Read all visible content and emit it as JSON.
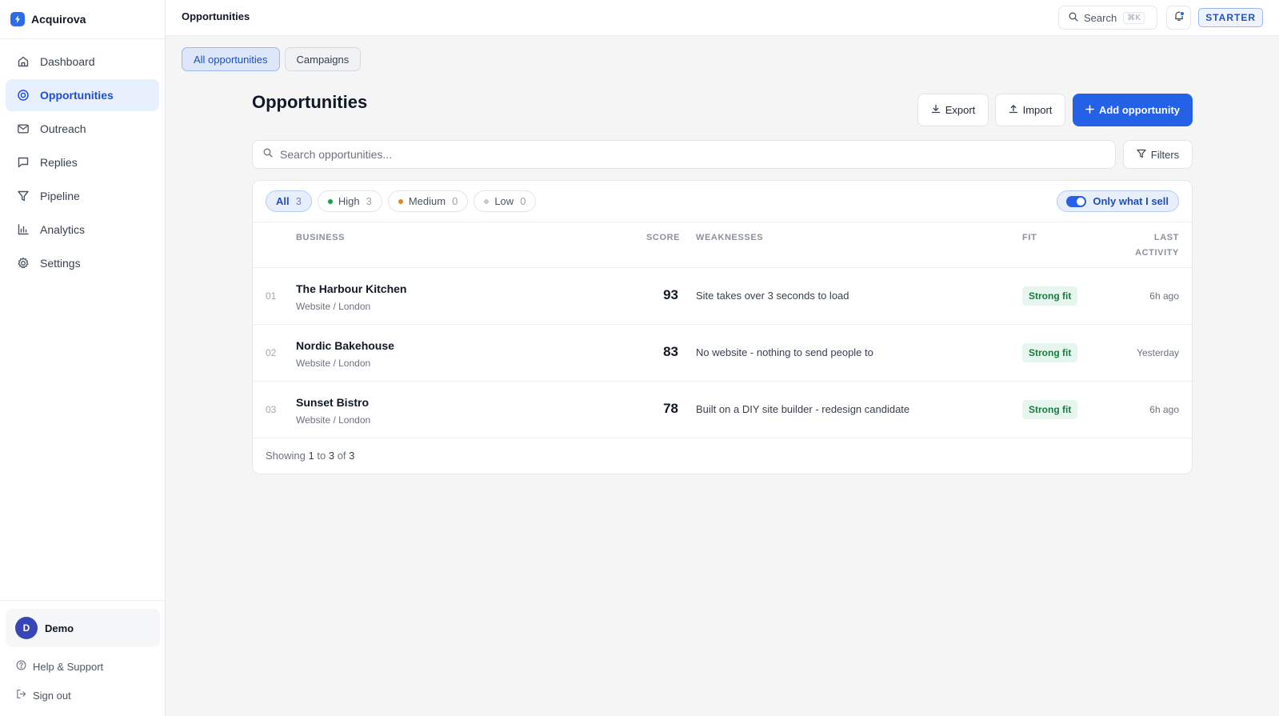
{
  "app": {
    "name": "Acquirova"
  },
  "sidebar": {
    "items": [
      {
        "label": "Dashboard",
        "icon": "home-icon",
        "active": false
      },
      {
        "label": "Opportunities",
        "icon": "target-icon",
        "active": true
      },
      {
        "label": "Outreach",
        "icon": "mail-icon",
        "active": false
      },
      {
        "label": "Replies",
        "icon": "message-icon",
        "active": false
      },
      {
        "label": "Pipeline",
        "icon": "funnel-icon",
        "active": false
      },
      {
        "label": "Analytics",
        "icon": "bar-chart-icon",
        "active": false
      },
      {
        "label": "Settings",
        "icon": "gear-icon",
        "active": false
      }
    ],
    "user": {
      "initial": "D",
      "name": "Demo"
    },
    "help_label": "Help & Support",
    "signout_label": "Sign out"
  },
  "topbar": {
    "title": "Opportunities",
    "search_label": "Search",
    "search_shortcut": "⌘K",
    "plan": "STARTER"
  },
  "tabs": [
    "All opportunities",
    "Campaigns"
  ],
  "header": {
    "title": "Opportunities",
    "export_label": "Export",
    "import_label": "Import",
    "add_label": "Add opportunity"
  },
  "search": {
    "placeholder": "Search opportunities..."
  },
  "filters_label": "Filters",
  "chips": [
    {
      "label": "All",
      "count": "3"
    },
    {
      "label": "High",
      "count": "3",
      "dot": "#16a34a"
    },
    {
      "label": "Medium",
      "count": "0",
      "dot": "#e08a1e"
    },
    {
      "label": "Low",
      "count": "0",
      "dot": "#c4c8ce"
    }
  ],
  "toggle": {
    "label": "Only what I sell",
    "on": true
  },
  "table": {
    "columns": {
      "business": "BUSINESS",
      "score": "SCORE",
      "weaknesses": "WEAKNESSES",
      "fit": "FIT",
      "activity_line1": "LAST",
      "activity_line2": "ACTIVITY"
    },
    "rows": [
      {
        "rank": "01",
        "name": "The Harbour Kitchen",
        "meta": "Website / London",
        "score": "93",
        "weakness": "Site takes over 3 seconds to load",
        "fit": "Strong fit",
        "activity": "6h ago"
      },
      {
        "rank": "02",
        "name": "Nordic Bakehouse",
        "meta": "Website / London",
        "score": "83",
        "weakness": "No website - nothing to send people to",
        "fit": "Strong fit",
        "activity": "Yesterday"
      },
      {
        "rank": "03",
        "name": "Sunset Bistro",
        "meta": "Website / London",
        "score": "78",
        "weakness": "Built on a DIY site builder - redesign candidate",
        "fit": "Strong fit",
        "activity": "6h ago"
      }
    ]
  },
  "pagination": {
    "prefix": "Showing",
    "from": "1",
    "to_word": "to",
    "to": "3",
    "of_word": "of",
    "total": "3"
  },
  "colors": {
    "accent": "#2461e6",
    "active_nav_bg": "#e9f0fd",
    "fit_bg": "#e6f6ee",
    "fit_text": "#15803d"
  }
}
